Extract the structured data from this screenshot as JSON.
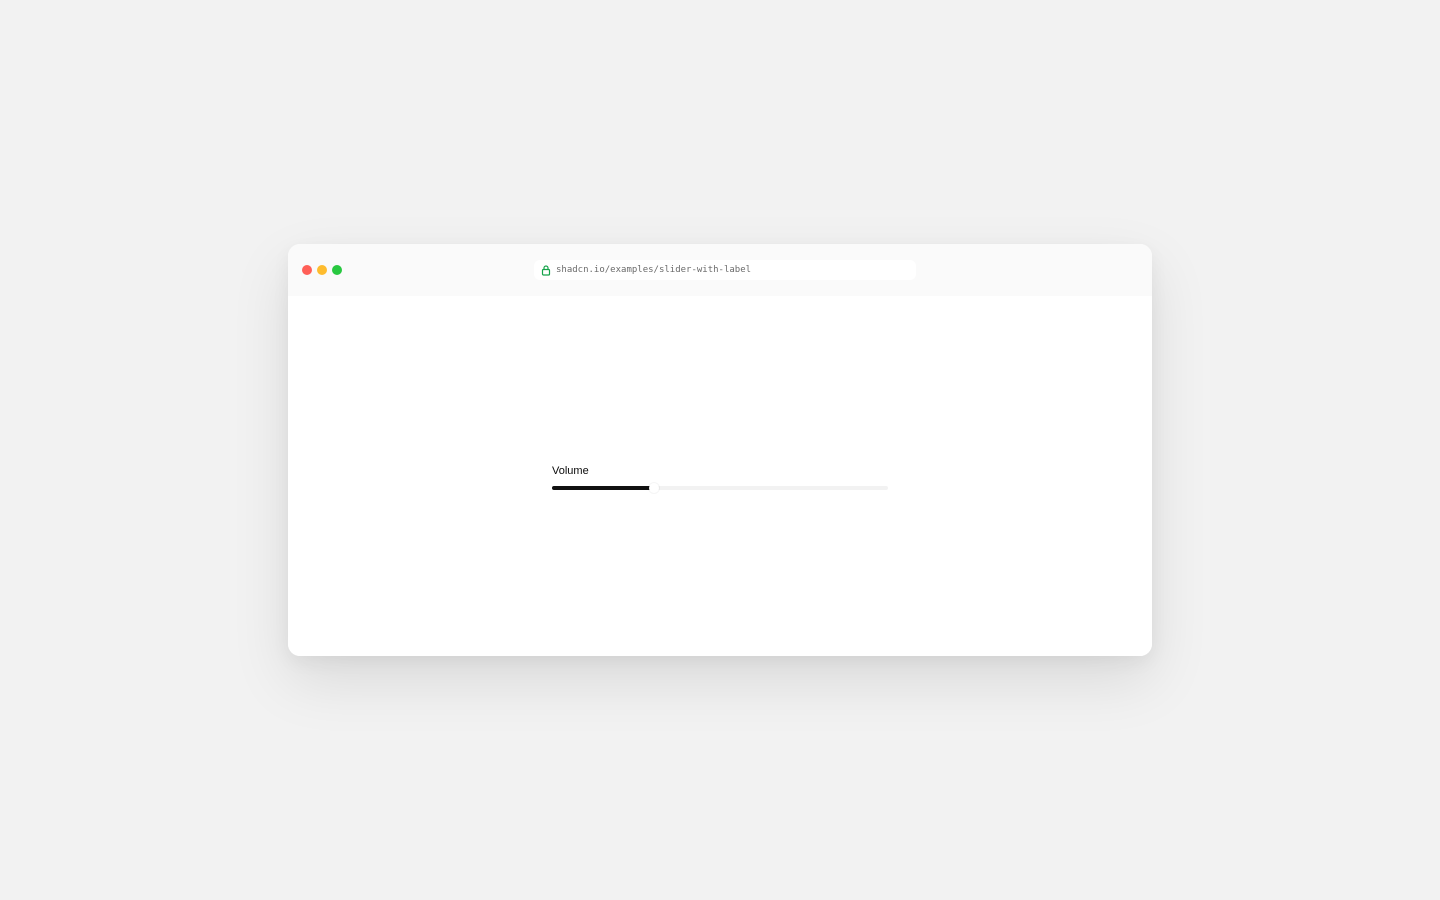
{
  "browser": {
    "url": "shadcn.io/examples/slider-with-label",
    "lock_icon": "lock-icon",
    "traffic_lights": {
      "close": "#ff5f57",
      "minimize": "#febc2e",
      "maximize": "#28c840"
    },
    "lock_color": "#16a34a"
  },
  "slider": {
    "label": "Volume",
    "value": 30,
    "min": 0,
    "max": 100,
    "range_color": "#111111",
    "track_color": "#f2f2f2"
  }
}
